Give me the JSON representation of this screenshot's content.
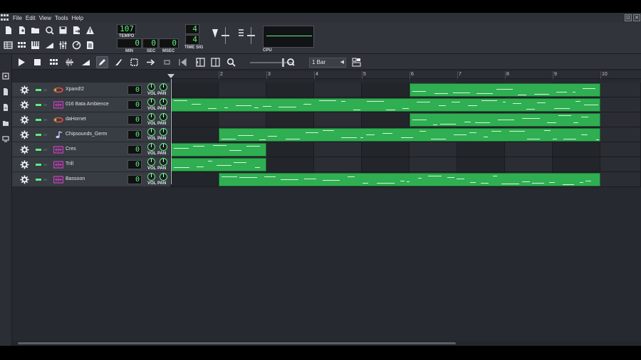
{
  "window": {
    "menu_items": [
      "File",
      "Edit",
      "View",
      "Tools",
      "Help"
    ],
    "window_buttons": [
      "⊡",
      "✕"
    ]
  },
  "toolbar": {
    "project_buttons": [
      "new-project-icon",
      "new-from-template-icon",
      "open-project-icon",
      "recent-projects-icon",
      "save-icon",
      "export-icon",
      "export-tracks-icon"
    ],
    "window_buttons": [
      "song-editor-icon",
      "beat-bassline-icon",
      "piano-roll-icon",
      "automation-editor-icon",
      "mixer-icon",
      "controller-rack-icon",
      "project-notes-icon"
    ],
    "tempo": {
      "value": "107",
      "label": "TEMPO"
    },
    "time": {
      "min": "0",
      "min_label": "MIN",
      "sec": "0",
      "sec_label": "SEC",
      "msec": "0",
      "msec_label": "MSEC"
    },
    "time_sig": {
      "numerator": "4",
      "denominator": "4",
      "label": "TIME SIG"
    },
    "cpu_label": "CPU"
  },
  "song_editor": {
    "quantize": "1 Bar",
    "ruler_labels": [
      "2",
      "3",
      "4",
      "5",
      "6",
      "7",
      "8",
      "9",
      "10"
    ],
    "tracks": [
      {
        "name": "Xpand!2",
        "value": "0",
        "vol": "VOL",
        "pan": "PAN",
        "icon": "vst-plugin-icon",
        "patterns": [
          [
            5,
            9
          ]
        ]
      },
      {
        "name": "016 Bata Ambience",
        "value": "0",
        "vol": "VOL",
        "pan": "PAN",
        "icon": "sample-clip-icon",
        "patterns": [
          [
            0,
            9
          ]
        ]
      },
      {
        "name": "daHornet",
        "value": "0",
        "vol": "VOL",
        "pan": "PAN",
        "icon": "vst-plugin-icon",
        "patterns": [
          [
            5,
            9
          ]
        ]
      },
      {
        "name": "Chipsounds_Germ",
        "value": "0",
        "vol": "VOL",
        "pan": "PAN",
        "icon": "music-note-icon",
        "patterns": [
          [
            1,
            9
          ]
        ]
      },
      {
        "name": "Cres",
        "value": "0",
        "vol": "VOL",
        "pan": "PAN",
        "icon": "sample-clip-icon",
        "patterns": [
          [
            0,
            2
          ]
        ]
      },
      {
        "name": "Trill",
        "value": "0",
        "vol": "VOL",
        "pan": "PAN",
        "icon": "sample-clip-icon",
        "patterns": [
          [
            0,
            2
          ]
        ]
      },
      {
        "name": "Bassoon",
        "value": "0",
        "vol": "VOL",
        "pan": "PAN",
        "icon": "sample-clip-icon",
        "patterns": [
          [
            1,
            9
          ]
        ]
      }
    ]
  },
  "colors": {
    "background": "#26292f",
    "panel": "#31353b",
    "pattern_green": "#2fae52",
    "lcd_green": "#5df07a",
    "sample_icon_magenta": "#d43dc5",
    "vst_icon_red": "#e2503a"
  }
}
